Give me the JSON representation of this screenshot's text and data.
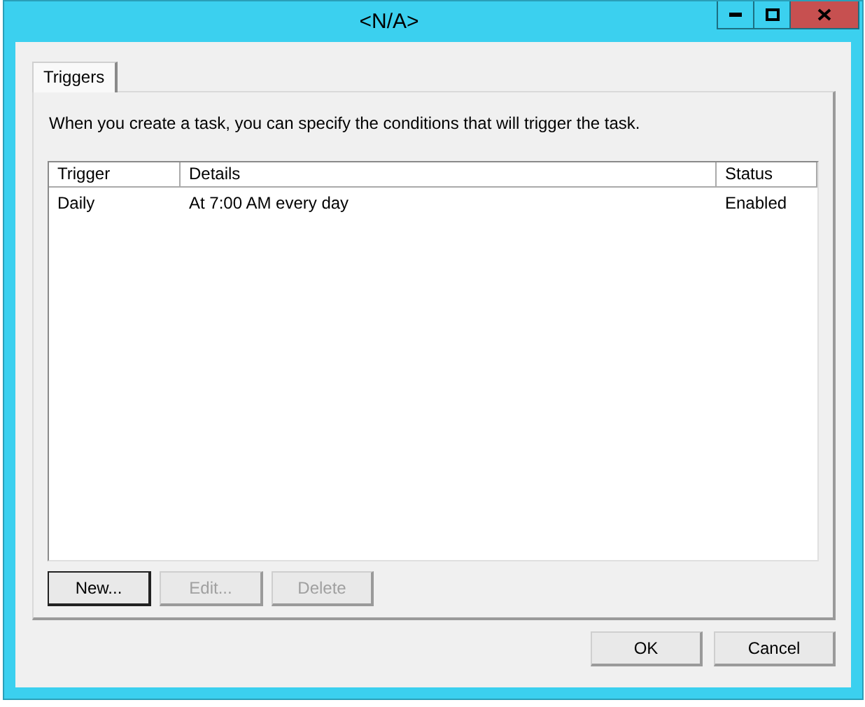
{
  "window": {
    "title": "<N/A>",
    "controls": [
      {
        "kind": "minimize"
      },
      {
        "kind": "maximize"
      },
      {
        "kind": "close"
      }
    ]
  },
  "tabs": [
    {
      "label": "Triggers",
      "selected": true
    }
  ],
  "description": "When you create a task, you can specify the conditions that will trigger the task.",
  "table": {
    "columns": [
      "Trigger",
      "Details",
      "Status"
    ],
    "rows": [
      [
        "Daily",
        "At 7:00 AM every day",
        "Enabled"
      ]
    ]
  },
  "list_buttons": [
    {
      "label": "New...",
      "disabled": false,
      "default": true
    },
    {
      "label": "Edit...",
      "disabled": true,
      "default": false
    },
    {
      "label": "Delete",
      "disabled": true,
      "default": false
    }
  ],
  "dialog_buttons": [
    {
      "label": "OK"
    },
    {
      "label": "Cancel"
    }
  ]
}
